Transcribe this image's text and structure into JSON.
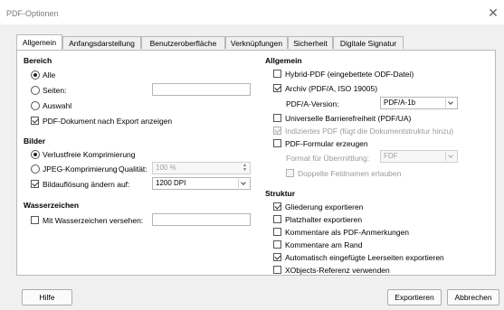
{
  "window": {
    "title": "PDF-Optionen",
    "close_glyph": "✕"
  },
  "tabs": [
    {
      "label": "Allgemein",
      "active": true
    },
    {
      "label": "Anfangsdarstellung"
    },
    {
      "label": "Benutzeroberfläche"
    },
    {
      "label": "Verknüpfungen"
    },
    {
      "label": "Sicherheit"
    },
    {
      "label": "Digitale Signatur"
    }
  ],
  "bereich": {
    "heading": "Bereich",
    "alle": "Alle",
    "seiten": "Seiten:",
    "seiten_value": "",
    "auswahl": "Auswahl",
    "nach_export": "PDF-Dokument nach Export anzeigen"
  },
  "bilder": {
    "heading": "Bilder",
    "verlustfrei": "Verlustfreie Komprimierung",
    "jpeg": "JPEG-Komprimierung",
    "qualitaet": "Qualität:",
    "qualitaet_value": "100 %",
    "aufloesung": "Bildauflösung ändern auf:",
    "aufloesung_value": "1200 DPI"
  },
  "wasserzeichen": {
    "heading": "Wasserzeichen",
    "mit": "Mit Wasserzeichen versehen:",
    "value": ""
  },
  "allgemein": {
    "heading": "Allgemein",
    "hybrid": "Hybrid-PDF (eingebettete ODF-Datei)",
    "archiv": "Archiv (PDF/A, ISO 19005)",
    "pdfa_version_label": "PDF/A-Version:",
    "pdfa_version_value": "PDF/A-1b",
    "barrierefreiheit": "Universelle Barrierefreiheit (PDF/UA)",
    "indiziert": "Indiziertes PDF (fügt die Dokumentstruktur hinzu)",
    "formular": "PDF-Formular erzeugen",
    "format_label": "Format für Übermittlung:",
    "format_value": "FDF",
    "doppelte": "Doppelte Feldnamen erlauben"
  },
  "struktur": {
    "heading": "Struktur",
    "gliederung": "Gliederung exportieren",
    "platzhalter": "Platzhalter exportieren",
    "kommentare_pdf": "Kommentare als PDF-Anmerkungen",
    "kommentare_rand": "Kommentare am Rand",
    "leerseiten": "Automatisch eingefügte Leerseiten exportieren",
    "xobjects": "XObjects-Referenz verwenden"
  },
  "buttons": {
    "hilfe": "Hilfe",
    "exportieren": "Exportieren",
    "abbrechen": "Abbrechen"
  }
}
